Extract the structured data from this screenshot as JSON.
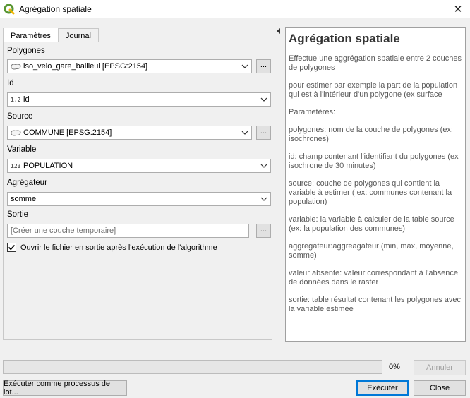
{
  "window": {
    "title": "Agrégation spatiale"
  },
  "tabs": [
    {
      "label": "Paramètres",
      "active": true
    },
    {
      "label": "Journal",
      "active": false
    }
  ],
  "params": {
    "polygones": {
      "label": "Polygones",
      "value": "iso_velo_gare_bailleul [EPSG:2154]",
      "icon": "polygon-layer-icon"
    },
    "id": {
      "label": "Id",
      "value": "id",
      "type_badge": "1.2",
      "icon": "decimal-field-icon"
    },
    "source": {
      "label": "Source",
      "value": "COMMUNE [EPSG:2154]",
      "icon": "polygon-layer-icon"
    },
    "variable": {
      "label": "Variable",
      "value": "POPULATION",
      "type_badge": "123",
      "icon": "integer-field-icon"
    },
    "agregateur": {
      "label": "Agrégateur",
      "value": "somme"
    },
    "sortie": {
      "label": "Sortie",
      "placeholder": "[Créer une couche temporaire]"
    },
    "dots": "...",
    "open_after": {
      "label": "Ouvrir le fichier en sortie après l'exécution de l'algorithme",
      "checked": true
    }
  },
  "help": {
    "title": "Agrégation spatiale",
    "paragraphs": [
      "Effectue une aggrégation spatiale entre 2 couches de polygones",
      "pour estimer par exemple la part de la population qui est à l'intérieur d'un polygone (ex surface",
      "Parametères:",
      "polygones: nom de la couche de polygones (ex: isochrones)",
      "id: champ contenant l'identifiant du polygones (ex isochrone de 30 minutes)",
      "source: couche de polygones qui contient la variable à estimer ( ex: communes contenant la population)",
      "variable: la variable à calculer de la table source (ex: la population des communes)",
      "aggregateur:aggreagateur (min, max, moyenne, somme)",
      "valeur absente: valeur correspondant à l'absence de données dans le raster",
      "sortie: table résultat contenant les polygones avec la variable estimée"
    ]
  },
  "progress": {
    "value": 0,
    "label": "0%"
  },
  "buttons": {
    "cancel": "Annuler",
    "batch": "Exécuter comme processus de lot...",
    "run": "Exécuter",
    "close": "Close"
  },
  "colors": {
    "accent": "#0078d7",
    "qgis_green": "#589632"
  }
}
